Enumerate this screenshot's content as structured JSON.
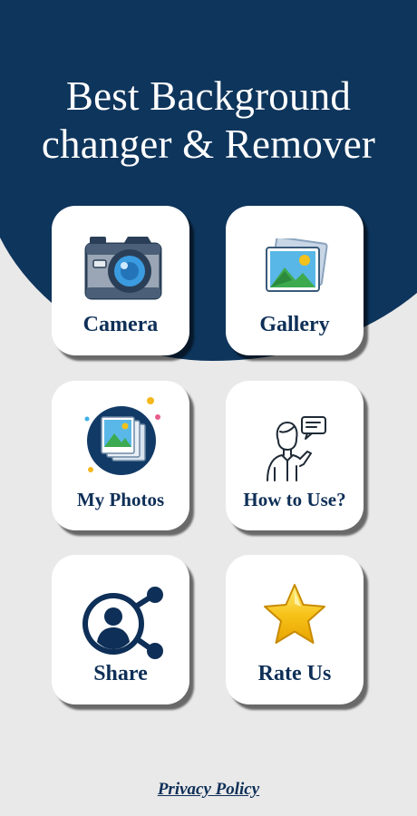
{
  "header": {
    "title_line1": "Best Background",
    "title_line2": "changer & Remover"
  },
  "menu": {
    "camera": {
      "label": "Camera",
      "icon": "camera-icon"
    },
    "gallery": {
      "label": "Gallery",
      "icon": "gallery-icon"
    },
    "my_photos": {
      "label": "My Photos",
      "icon": "photos-stack-icon"
    },
    "how_to_use": {
      "label": "How to Use?",
      "icon": "help-person-icon"
    },
    "share": {
      "label": "Share",
      "icon": "share-icon"
    },
    "rate_us": {
      "label": "Rate Us",
      "icon": "star-icon"
    }
  },
  "footer": {
    "privacy_label": "Privacy Policy"
  },
  "colors": {
    "navy": "#0e355c",
    "background": "#e9e9e9",
    "card": "#ffffff",
    "label_text": "#0e2f57",
    "star": "#f7c31a"
  }
}
